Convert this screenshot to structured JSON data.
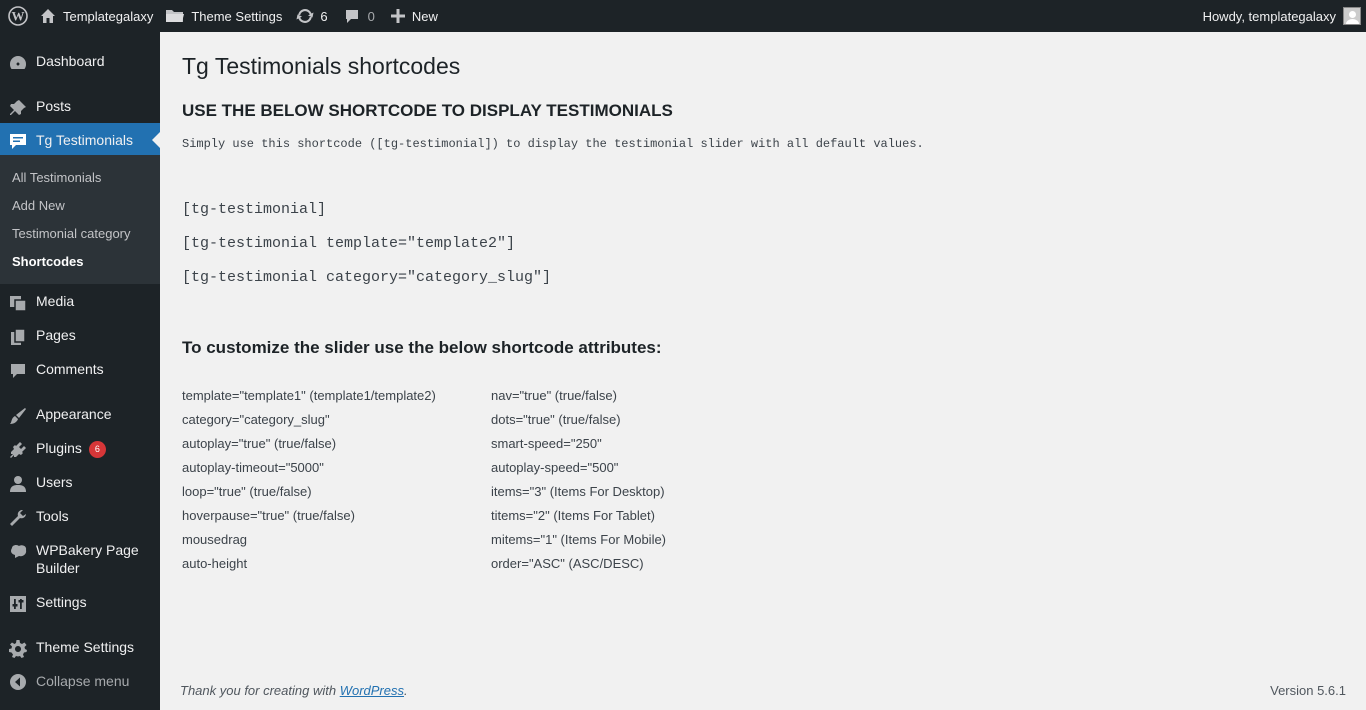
{
  "admin_bar": {
    "site_name": "Templategalaxy",
    "theme_settings": "Theme Settings",
    "updates_count": "6",
    "comments_count": "0",
    "new_label": "New",
    "greeting": "Howdy, templategalaxy"
  },
  "sidebar": {
    "dashboard": "Dashboard",
    "posts": "Posts",
    "tg_testimonials": "Tg Testimonials",
    "submenu": [
      "All Testimonials",
      "Add New",
      "Testimonial category",
      "Shortcodes"
    ],
    "media": "Media",
    "pages": "Pages",
    "comments": "Comments",
    "appearance": "Appearance",
    "plugins": "Plugins",
    "plugins_badge": "6",
    "users": "Users",
    "tools": "Tools",
    "wpbakery_line1": "WPBakery Page",
    "wpbakery_line2": "Builder",
    "settings": "Settings",
    "theme_settings": "Theme Settings",
    "collapse": "Collapse menu"
  },
  "main": {
    "title": "Tg Testimonials shortcodes",
    "heading": "USE THE BELOW SHORTCODE TO DISPLAY TESTIMONIALS",
    "intro": "Simply use this shortcode ([tg-testimonial]) to display the testimonial slider with all default values.",
    "shortcodes": [
      "[tg-testimonial]",
      "[tg-testimonial template=\"template2\"]",
      "[tg-testimonial category=\"category_slug\"]"
    ],
    "attributes_heading": "To customize the slider use the below shortcode attributes:",
    "attributes_left": [
      "template=\"template1\" (template1/template2)",
      "category=\"category_slug\"",
      "autoplay=\"true\" (true/false)",
      "autoplay-timeout=\"5000\"",
      "loop=\"true\" (true/false)",
      "hoverpause=\"true\" (true/false)",
      "mousedrag",
      "auto-height"
    ],
    "attributes_right": [
      "nav=\"true\" (true/false)",
      "dots=\"true\" (true/false)",
      "smart-speed=\"250\"",
      "autoplay-speed=\"500\"",
      "items=\"3\" (Items For Desktop)",
      "titems=\"2\" (Items For Tablet)",
      "mitems=\"1\" (Items For Mobile)",
      "order=\"ASC\" (ASC/DESC)"
    ]
  },
  "footer": {
    "thanks_prefix": "Thank you for creating with ",
    "wordpress_link": "WordPress",
    "thanks_suffix": ".",
    "version": "Version 5.6.1"
  },
  "colors": {
    "admin_bg": "#1d2327",
    "submenu_bg": "#2c3338",
    "accent": "#2271b1",
    "badge": "#d63638",
    "page_bg": "#f1f1f1"
  }
}
